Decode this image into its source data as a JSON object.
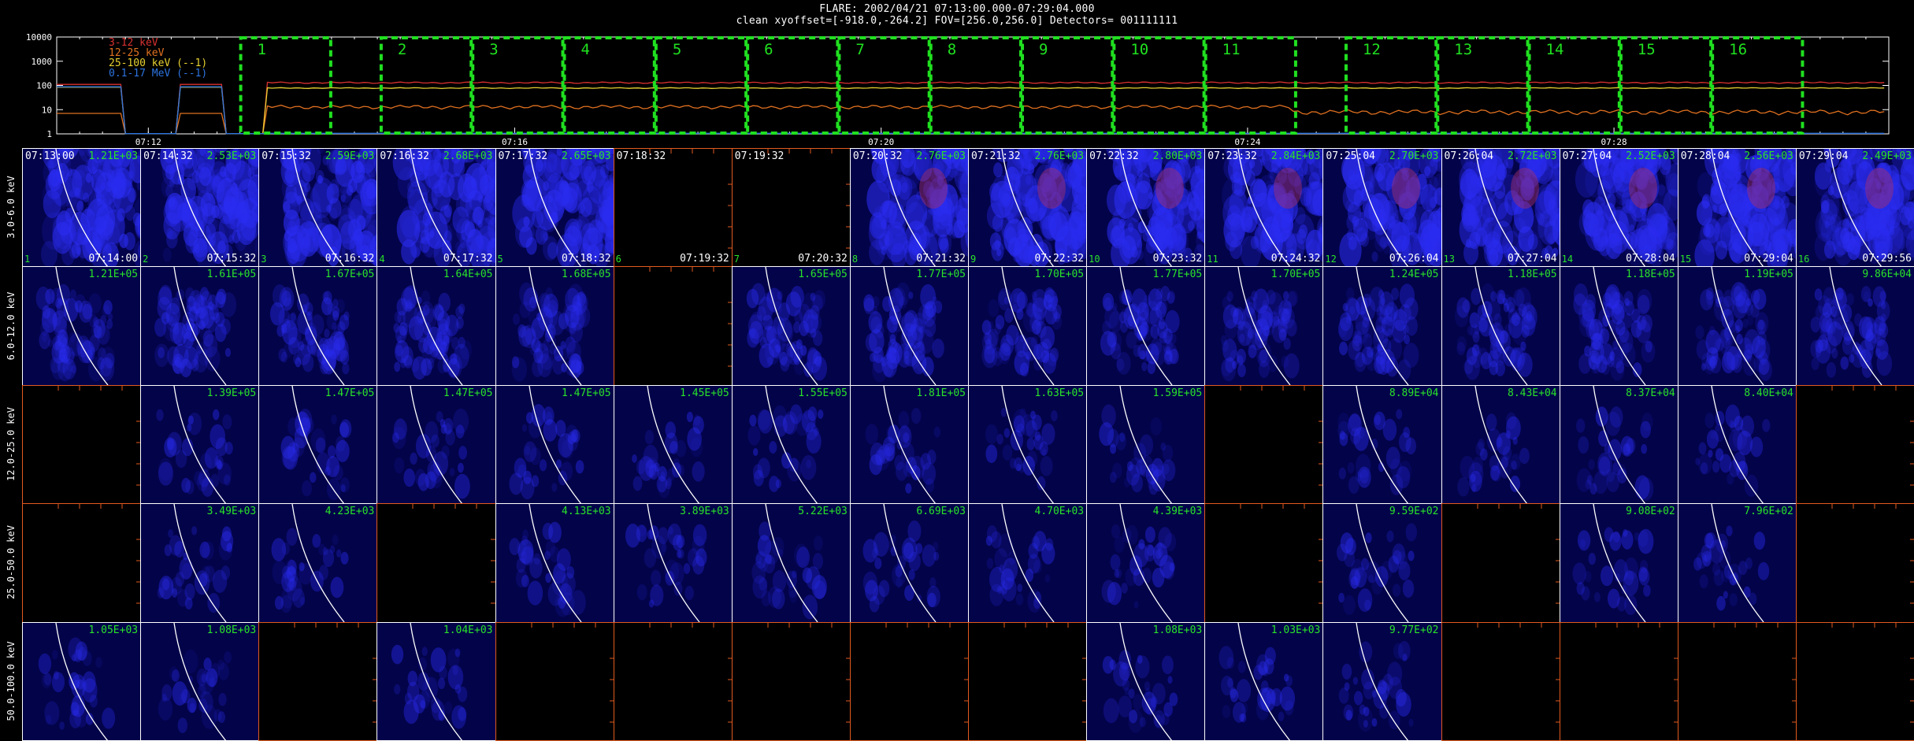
{
  "title": {
    "line1": "FLARE: 2002/04/21 07:13:00.000-07:29:04.000",
    "line2": "clean    xyoffset=[-918.0,-264.2]   FOV=[256.0,256.0]   Detectors= 001111111"
  },
  "lightcurve": {
    "y_ticks": [
      "10000",
      "1000",
      "100",
      "10",
      "1"
    ],
    "x_ticks": [
      "07:12",
      "07:16",
      "07:20",
      "07:24",
      "07:28"
    ],
    "legend": [
      {
        "label": "3-12 keV",
        "color": "#d83030"
      },
      {
        "label": "12-25 keV",
        "color": "#e07020"
      },
      {
        "label": "25-100 keV (--1)",
        "color": "#e6d030"
      },
      {
        "label": "0.1-17 MeV (--1)",
        "color": "#2d73e0"
      }
    ],
    "interval_labels": [
      "1",
      "2",
      "3",
      "4",
      "5",
      "6",
      "7",
      "8",
      "9",
      "10",
      "11",
      "12",
      "13",
      "14",
      "15",
      "16"
    ],
    "box_color": "#20e020"
  },
  "energy_bands": [
    "3.0-6.0 keV",
    "6.0-12.0 keV",
    "12.0-25.0 keV",
    "25.0-50.0 keV",
    "50.0-100.0 keV"
  ],
  "columns": [
    {
      "idx": "1",
      "start": "07:13:00",
      "end": "07:14:00"
    },
    {
      "idx": "2",
      "start": "07:14:32",
      "end": "07:15:32"
    },
    {
      "idx": "3",
      "start": "07:15:32",
      "end": "07:16:32"
    },
    {
      "idx": "4",
      "start": "07:16:32",
      "end": "07:17:32"
    },
    {
      "idx": "5",
      "start": "07:17:32",
      "end": "07:18:32"
    },
    {
      "idx": "6",
      "start": "07:18:32",
      "end": "07:19:32"
    },
    {
      "idx": "7",
      "start": "07:19:32",
      "end": "07:20:32"
    },
    {
      "idx": "8",
      "start": "07:20:32",
      "end": "07:21:32"
    },
    {
      "idx": "9",
      "start": "07:21:32",
      "end": "07:22:32"
    },
    {
      "idx": "10",
      "start": "07:22:32",
      "end": "07:23:32"
    },
    {
      "idx": "11",
      "start": "07:23:32",
      "end": "07:24:32"
    },
    {
      "idx": "12",
      "start": "07:25:04",
      "end": "07:26:04"
    },
    {
      "idx": "13",
      "start": "07:26:04",
      "end": "07:27:04"
    },
    {
      "idx": "14",
      "start": "07:27:04",
      "end": "07:28:04"
    },
    {
      "idx": "15",
      "start": "07:28:04",
      "end": "07:29:04"
    },
    {
      "idx": "16",
      "start": "07:29:04",
      "end": "07:29:56"
    }
  ],
  "peaks": [
    [
      "1.21E+03",
      "2.53E+03",
      "2.59E+03",
      "2.68E+03",
      "2.65E+03",
      "",
      "",
      "2.76E+03",
      "2.76E+03",
      "2.80E+03",
      "2.84E+03",
      "2.70E+03",
      "2.72E+03",
      "2.52E+03",
      "2.56E+03",
      "2.49E+03"
    ],
    [
      "1.21E+05",
      "1.61E+05",
      "1.67E+05",
      "1.64E+05",
      "1.68E+05",
      "",
      "1.65E+05",
      "1.77E+05",
      "1.70E+05",
      "1.77E+05",
      "1.70E+05",
      "1.24E+05",
      "1.18E+05",
      "1.18E+05",
      "1.19E+05",
      "9.86E+04"
    ],
    [
      "",
      "1.39E+05",
      "1.47E+05",
      "1.47E+05",
      "1.47E+05",
      "1.45E+05",
      "1.55E+05",
      "1.81E+05",
      "1.63E+05",
      "1.59E+05",
      "",
      "8.89E+04",
      "8.43E+04",
      "8.37E+04",
      "8.40E+04",
      ""
    ],
    [
      "",
      "3.49E+03",
      "4.23E+03",
      "",
      "4.13E+03",
      "3.89E+03",
      "5.22E+03",
      "6.69E+03",
      "4.70E+03",
      "4.39E+03",
      "",
      "9.59E+02",
      "",
      "9.08E+02",
      "7.96E+02",
      ""
    ],
    [
      "1.05E+03",
      "1.08E+03",
      "",
      "1.04E+03",
      "",
      "",
      "",
      "",
      "",
      "1.08E+03",
      "1.03E+03",
      "9.77E+02",
      "",
      "",
      "",
      ""
    ]
  ],
  "colors": {
    "image_bg": "#03034a",
    "limb": "#ffffff",
    "empty_border": "#e25a1f",
    "peak_text": "#29e329"
  }
}
